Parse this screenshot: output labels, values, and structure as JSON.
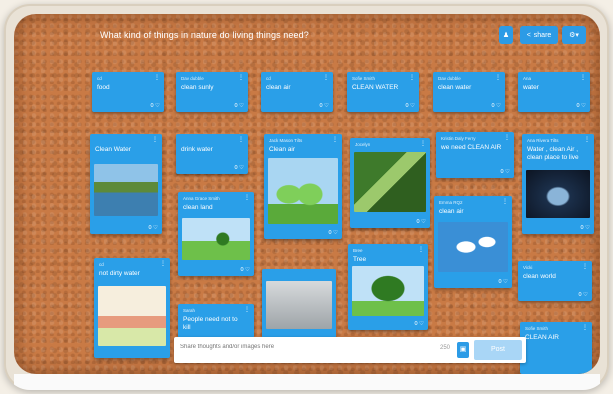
{
  "board": {
    "title": "What kind of things in nature do living things need?"
  },
  "toolbar": {
    "user_icon": "person-icon",
    "share_label": "share",
    "share_icon": "share-icon",
    "settings_icon": "gear-icon"
  },
  "cards": [
    {
      "id": "c1",
      "author": "cd",
      "text": "food"
    },
    {
      "id": "c2",
      "author": "Dav dubble",
      "text": "clean sunly"
    },
    {
      "id": "c3",
      "author": "cd",
      "text": "clean air"
    },
    {
      "id": "c4",
      "author": "Sofie Smith",
      "text": "CLEAN WATER"
    },
    {
      "id": "c5",
      "author": "Dav dubble",
      "text": "clean water"
    },
    {
      "id": "c6",
      "author": "Ana",
      "text": "water"
    },
    {
      "id": "c7",
      "author": "",
      "text": "Clean Water"
    },
    {
      "id": "c8",
      "author": "",
      "text": "drink water"
    },
    {
      "id": "c9",
      "author": "Jack Mason Tilts",
      "text": "Clean air"
    },
    {
      "id": "c10",
      "author": "Jocelyn",
      "text": ""
    },
    {
      "id": "c11",
      "author": "Kristin Daly Ferry",
      "text": "we need CLEAN AIR"
    },
    {
      "id": "c12",
      "author": "Ana Rivera Tilts",
      "text": "Water , clean Air , clean place to live"
    },
    {
      "id": "c13",
      "author": "Anna Grace Smith",
      "text": "clean land"
    },
    {
      "id": "c14",
      "author": "Emma RQ2",
      "text": "clean air"
    },
    {
      "id": "c15",
      "author": "Bree",
      "text": "Tree"
    },
    {
      "id": "c16",
      "author": "cd",
      "text": "not dirty water"
    },
    {
      "id": "c17",
      "author": "Vicki",
      "text": "clean world"
    },
    {
      "id": "c18",
      "author": "Sarah",
      "text": "People need not to kill"
    },
    {
      "id": "c19",
      "author": "Sofie Smith",
      "text": "CLEAN AIR"
    }
  ],
  "composer": {
    "placeholder": "Share thoughts and/or images here",
    "counter": "250",
    "post_label": "Post",
    "attach_icon": "image-icon"
  },
  "icons": {
    "card_menu": "menu-dots-icon",
    "like": "heart-icon"
  },
  "colors": {
    "card": "#2a9fe8",
    "button": "#2c9be6",
    "cork": "#c97a45"
  }
}
